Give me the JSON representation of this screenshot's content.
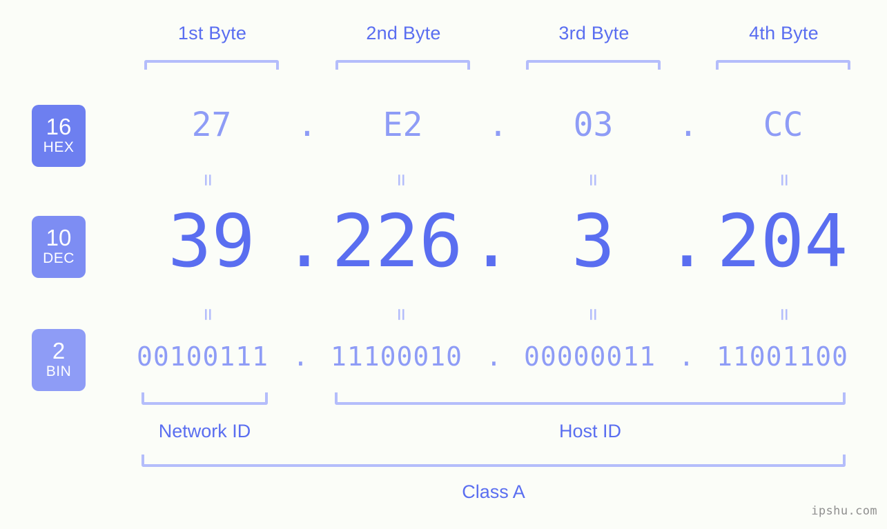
{
  "meta": {
    "watermark": "ipshu.com",
    "accent_strong": "#5a6ef0",
    "accent_mid": "#8e9cf6",
    "accent_light": "#b4bdfb",
    "background": "#fbfdf8"
  },
  "byte_headers": [
    {
      "label": "1st Byte"
    },
    {
      "label": "2nd Byte"
    },
    {
      "label": "3rd Byte"
    },
    {
      "label": "4th Byte"
    }
  ],
  "radix_badges": [
    {
      "number": "16",
      "name": "HEX",
      "color": "#6d7ff0"
    },
    {
      "number": "10",
      "name": "DEC",
      "color": "#7d8df3"
    },
    {
      "number": "2",
      "name": "BIN",
      "color": "#8e9cf6"
    }
  ],
  "rows": {
    "hex": {
      "octets": [
        "27",
        "E2",
        "03",
        "CC"
      ],
      "separator": "."
    },
    "dec": {
      "octets": [
        "39",
        "226",
        "3",
        "204"
      ],
      "separator": "."
    },
    "bin": {
      "octets": [
        "00100111",
        "11100010",
        "00000011",
        "11001100"
      ],
      "separator": "."
    }
  },
  "equals": {
    "glyph": "="
  },
  "id_labels": {
    "network": "Network ID",
    "host": "Host ID"
  },
  "class_label": "Class A"
}
